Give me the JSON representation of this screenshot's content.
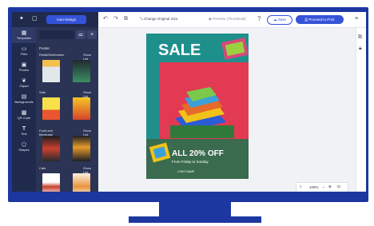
{
  "toolbar": {
    "auto_design": "Auto Design",
    "change_size": "Change Original Size",
    "preview": "Preview (Thumbnail)",
    "save": "Save",
    "proceed": "Proceed to Print",
    "icons": [
      "sparkle-icon",
      "undo-icon",
      "redo-icon",
      "copy-icon",
      "resize-icon",
      "eye-icon",
      "help-icon",
      "cloud-icon",
      "printer-icon",
      "menu-icon"
    ]
  },
  "rail": {
    "items": [
      {
        "label": "Templates",
        "icon": "grid-icon"
      },
      {
        "label": "Files",
        "icon": "folder-icon"
      },
      {
        "label": "Photos",
        "icon": "image-icon"
      },
      {
        "label": "Clipart",
        "icon": "clipart-icon"
      },
      {
        "label": "Backgrounds",
        "icon": "background-icon"
      },
      {
        "label": "QR Code",
        "icon": "qr-icon"
      },
      {
        "label": "Text",
        "icon": "text-icon"
      },
      {
        "label": "Shapes",
        "icon": "shapes-icon"
      }
    ]
  },
  "panel": {
    "title": "Poster",
    "sections": [
      {
        "name": "Retail/Distribution",
        "show": "Show List"
      },
      {
        "name": "Sale",
        "show": "Show List"
      },
      {
        "name": "Food and Beverage",
        "show": "Show List"
      },
      {
        "name": "Cafe",
        "show": "Show List"
      }
    ]
  },
  "poster": {
    "headline": "SALE",
    "offer": "ALL 20% OFF",
    "sub": "From Friday to Sunday",
    "brand": "LOGO NAME",
    "colors": {
      "teal": "#1f8f8c",
      "red": "#e23a52",
      "green": "#3a6b4f"
    }
  },
  "zoom": {
    "value": "100%"
  },
  "colors": {
    "navy": "#1d37a0",
    "primary": "#3553d8",
    "rail": "#202a4c",
    "panel": "#2b3455"
  }
}
